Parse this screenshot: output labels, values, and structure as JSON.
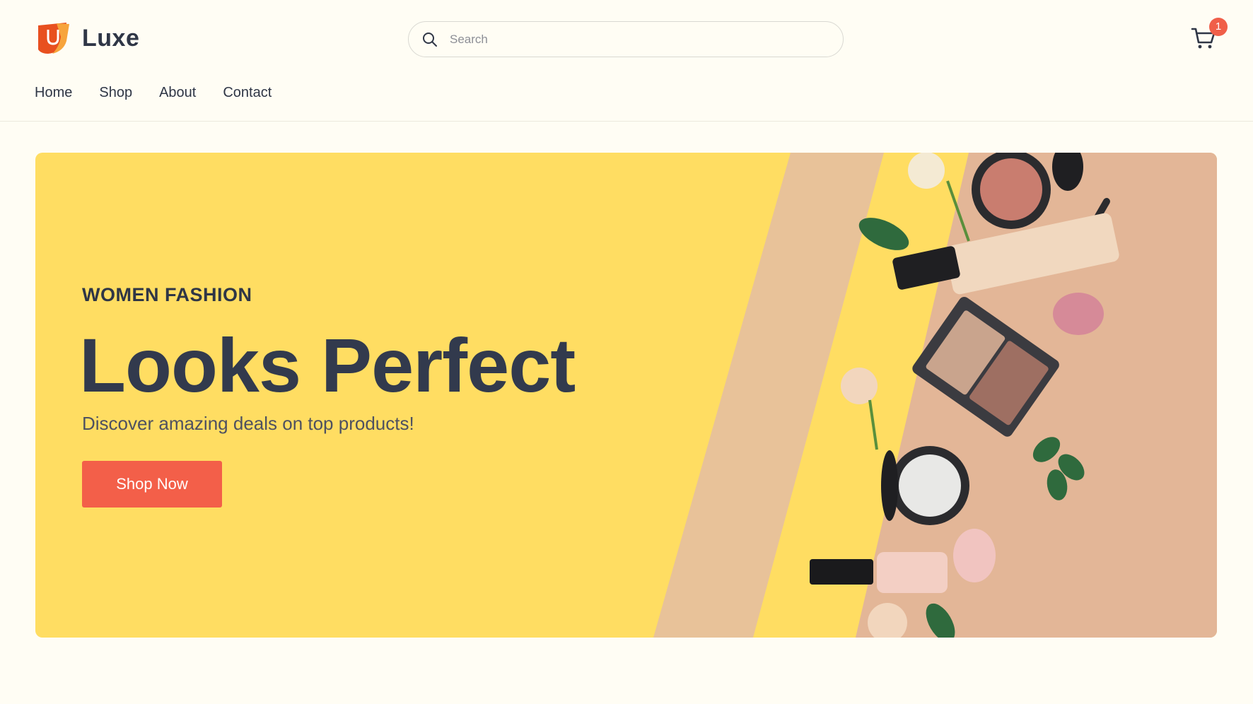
{
  "brand": {
    "name": "Luxe",
    "logo_icon": "shopping-bag-logo-icon"
  },
  "search": {
    "placeholder": "Search",
    "value": "",
    "icon": "search-icon"
  },
  "cart": {
    "icon": "cart-icon",
    "count": "1"
  },
  "nav": {
    "items": [
      {
        "label": "Home"
      },
      {
        "label": "Shop"
      },
      {
        "label": "About"
      },
      {
        "label": "Contact"
      }
    ]
  },
  "hero": {
    "eyebrow": "WOMEN FASHION",
    "title": "Looks Perfect",
    "subtitle": "Discover amazing deals on top products!",
    "cta_label": "Shop Now"
  },
  "colors": {
    "page_bg": "#fffdf4",
    "hero_bg": "#ffdd62",
    "accent": "#f35f49",
    "text": "#2f3646",
    "beige": "#e8c299",
    "skin": "#e3b697"
  }
}
